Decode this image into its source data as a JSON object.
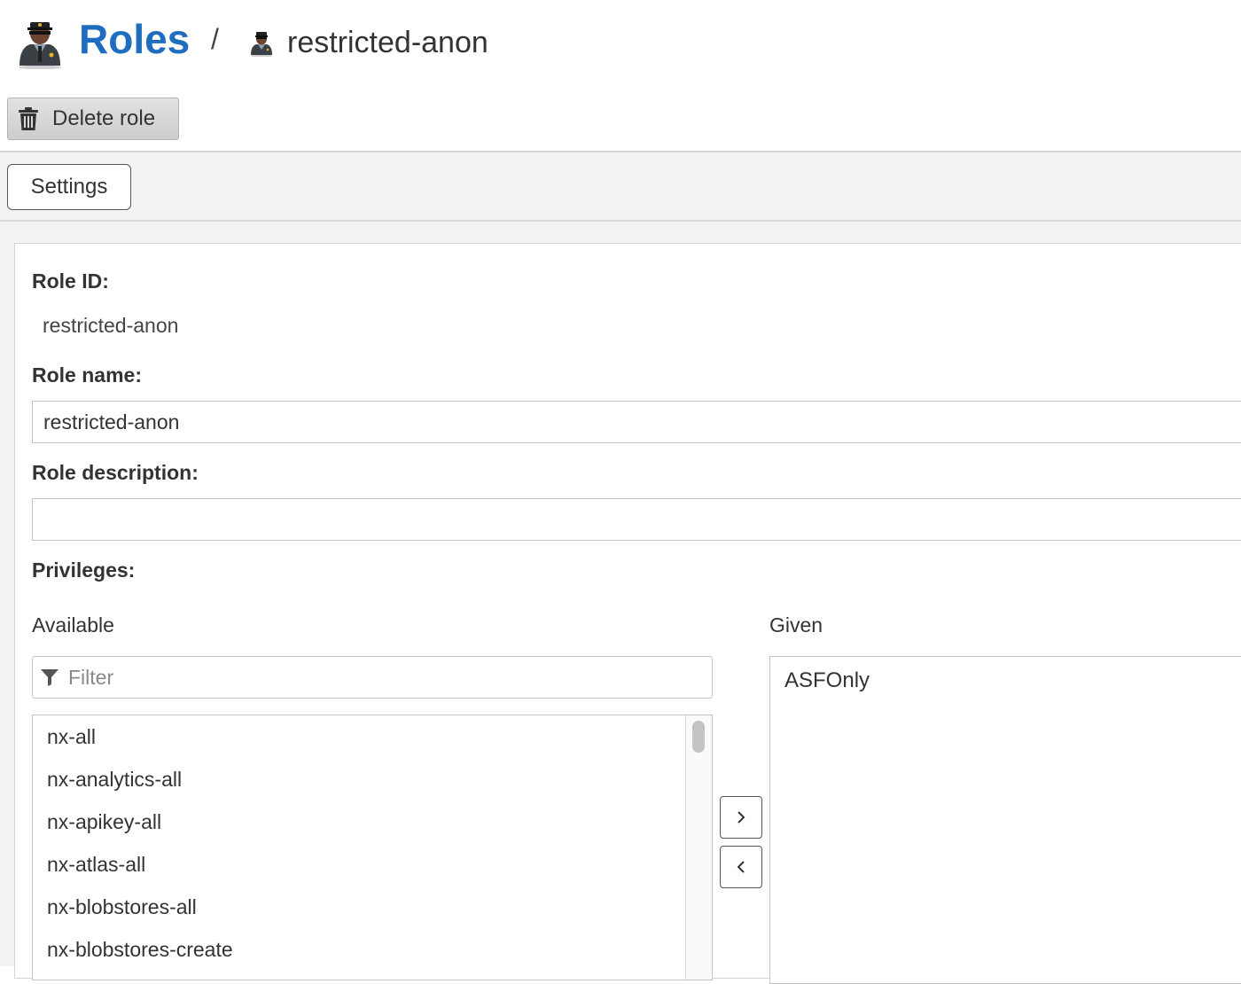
{
  "header": {
    "breadcrumb_root": "Roles",
    "separator": "/",
    "current": "restricted-anon",
    "root_icon": "user-officer-icon",
    "current_icon": "user-officer-icon"
  },
  "toolbar": {
    "delete_label": "Delete role",
    "delete_icon": "trash-icon"
  },
  "tabs": [
    {
      "label": "Settings"
    }
  ],
  "form": {
    "role_id_label": "Role ID:",
    "role_id_value": "restricted-anon",
    "role_name_label": "Role name:",
    "role_name_value": "restricted-anon",
    "role_description_label": "Role description:",
    "role_description_value": "",
    "privileges_label": "Privileges:"
  },
  "privileges": {
    "available_label": "Available",
    "filter_placeholder": "Filter",
    "filter_icon": "filter-icon",
    "available": [
      "nx-all",
      "nx-analytics-all",
      "nx-apikey-all",
      "nx-atlas-all",
      "nx-blobstores-all",
      "nx-blobstores-create"
    ],
    "add_button": "›",
    "remove_button": "‹",
    "given_label": "Given",
    "given": [
      "ASFOnly"
    ]
  },
  "colors": {
    "accent": "#1e6dbf",
    "band": "#f3f3f3",
    "border": "#c4c4c4"
  }
}
